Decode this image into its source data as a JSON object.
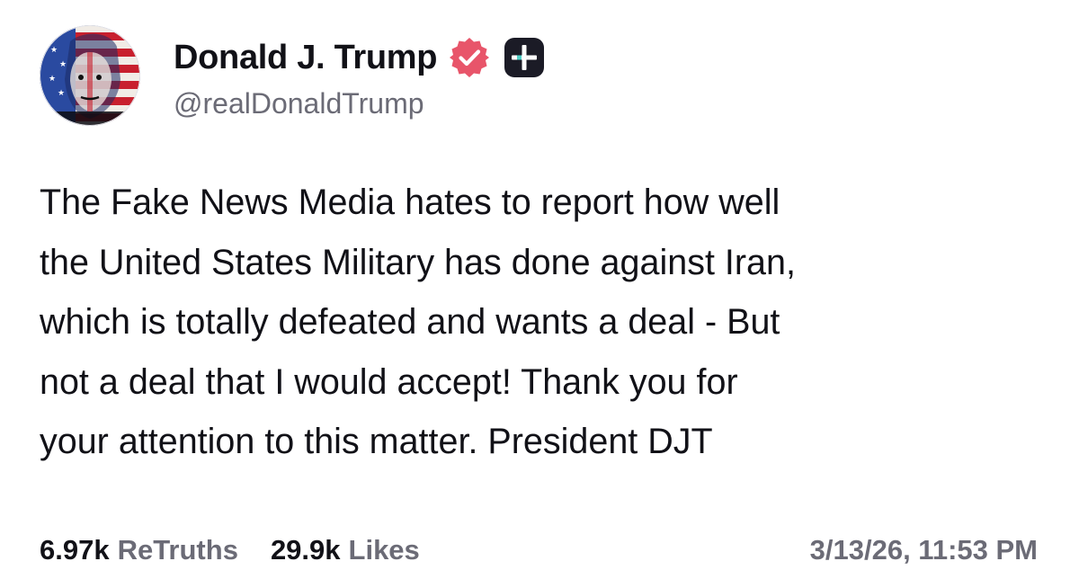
{
  "author": {
    "display_name": "Donald J. Trump",
    "handle": "@realDonaldTrump",
    "avatar_icon": "profile-avatar-flag-portrait",
    "verified_icon": "verified-badge-icon",
    "plus_icon": "truth-plus-badge-icon"
  },
  "post": {
    "lines": [
      "The Fake News Media hates to report how well",
      "the United States Military has done against Iran,",
      "which is totally defeated and wants a deal - But",
      "not a deal that I would accept! Thank you for",
      "your attention to this matter. President DJT"
    ]
  },
  "stats": {
    "retruths_count": "6.97k",
    "retruths_label": "ReTruths",
    "likes_count": "29.9k",
    "likes_label": "Likes"
  },
  "timestamp": "3/13/26, 11:53 PM",
  "colors": {
    "verified_badge": "#e8556a",
    "plus_badge_bg": "#1b1b26",
    "plus_badge_accent": "#4fd0c8",
    "muted_text": "#6b6b76",
    "text": "#111117"
  }
}
